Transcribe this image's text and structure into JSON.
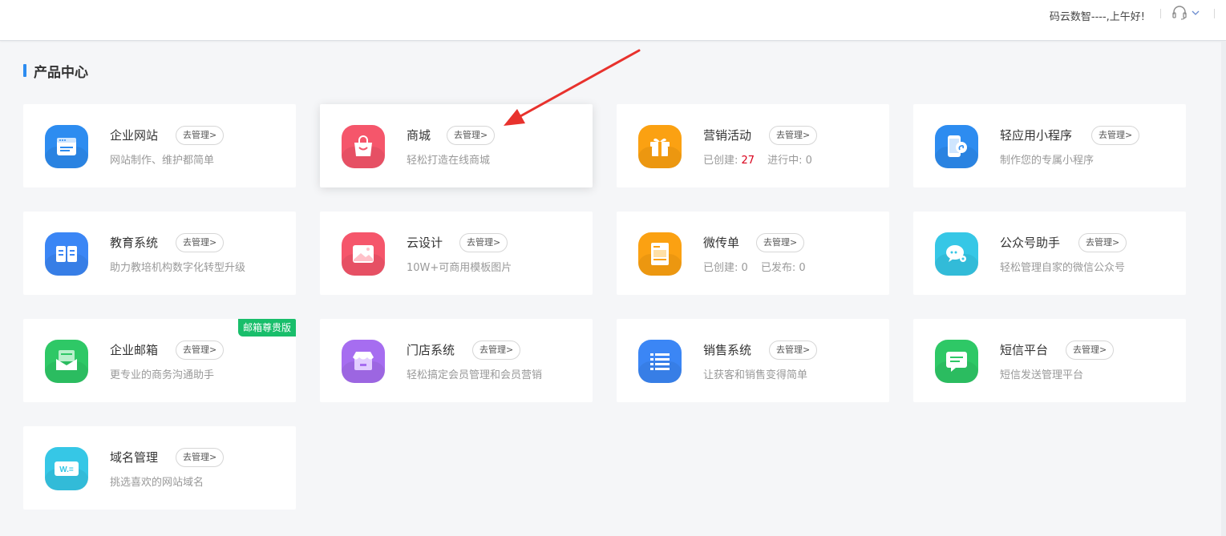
{
  "header": {
    "greeting": "码云数智----,上午好!",
    "headset_icon": "headset-icon",
    "dropdown_icon": "chevron-down-icon"
  },
  "section": {
    "title": "产品中心",
    "accent_color": "#2d8cf0"
  },
  "manage_label": "去管理>",
  "cards": [
    {
      "name": "企业网站",
      "desc": "网站制作、维护都简单",
      "icon": "website-icon",
      "color": "#2d8cf0"
    },
    {
      "name": "商城",
      "desc": "轻松打造在线商城",
      "icon": "shopping-bag-icon",
      "color": "#f5566b"
    },
    {
      "name": "营销活动",
      "stats": [
        {
          "label": "已创建:",
          "value": "27"
        },
        {
          "label": "进行中:",
          "value": "0"
        }
      ],
      "icon": "gift-icon",
      "color": "#fba112"
    },
    {
      "name": "轻应用小程序",
      "desc": "制作您的专属小程序",
      "icon": "mini-program-icon",
      "color": "#2d8cf0"
    },
    {
      "name": "教育系统",
      "desc": "助力教培机构数字化转型升级",
      "icon": "book-icon",
      "color": "#3b86f5"
    },
    {
      "name": "云设计",
      "desc": "10W+可商用模板图片",
      "icon": "image-icon",
      "color": "#f5566b"
    },
    {
      "name": "微传单",
      "stats": [
        {
          "label": "已创建:",
          "value": "0"
        },
        {
          "label": "已发布:",
          "value": "0"
        }
      ],
      "icon": "flyer-icon",
      "color": "#fba112"
    },
    {
      "name": "公众号助手",
      "desc": "轻松管理自家的微信公众号",
      "icon": "wechat-icon",
      "color": "#36c7e6"
    },
    {
      "name": "企业邮箱",
      "desc": "更专业的商务沟通助手",
      "icon": "mail-icon",
      "color": "#2ec866",
      "badge": "邮箱尊贵版"
    },
    {
      "name": "门店系统",
      "desc": "轻松搞定会员管理和会员营销",
      "icon": "store-icon",
      "color": "#a66df0"
    },
    {
      "name": "销售系统",
      "desc": "让获客和销售变得简单",
      "icon": "list-icon",
      "color": "#3b86f5"
    },
    {
      "name": "短信平台",
      "desc": "短信发送管理平台",
      "icon": "sms-icon",
      "color": "#2ec866"
    },
    {
      "name": "域名管理",
      "desc": "挑选喜欢的网站域名",
      "icon": "domain-icon",
      "color": "#36c7e6",
      "icon_text": "W.="
    }
  ]
}
